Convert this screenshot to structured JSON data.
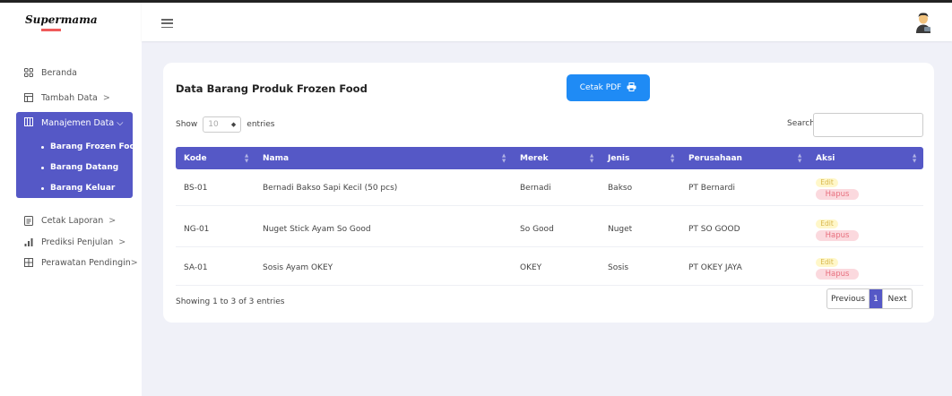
{
  "app": {
    "logo_text": "Supermama"
  },
  "sidebar": {
    "items": [
      {
        "label": "Beranda",
        "icon": "grid-icon",
        "arrow": ""
      },
      {
        "label": "Tambah Data",
        "icon": "table-icon",
        "arrow": ">"
      },
      {
        "label": "Manajemen Data",
        "icon": "columns-icon",
        "arrow": "⌵"
      },
      {
        "label": "Cetak Laporan",
        "icon": "document-icon",
        "arrow": ">"
      },
      {
        "label": "Prediksi Penjulan",
        "icon": "bar-chart-icon",
        "arrow": ">"
      },
      {
        "label": "Perawatan Pendingin",
        "icon": "grid-plus-icon",
        "arrow": ">"
      }
    ],
    "sub_items": [
      "Barang Frozen Food",
      "Barang Datang",
      "Barang Keluar"
    ],
    "accent": "#5558c6"
  },
  "main": {
    "title": "Data Barang Produk Frozen Food",
    "pdf_button": "Cetak PDF",
    "show_label": "Show",
    "entries_value": "10",
    "entries_label": "entries",
    "search_label": "Search:",
    "columns": [
      "Kode",
      "Nama",
      "Merek",
      "Jenis",
      "Perusahaan",
      "Aksi"
    ],
    "rows": [
      {
        "kode": "BS-01",
        "nama": "Bernadi Bakso Sapi Kecil (50 pcs)",
        "merek": "Bernadi",
        "jenis": "Bakso",
        "perusahaan": "PT Bernardi"
      },
      {
        "kode": "NG-01",
        "nama": "Nuget Stick Ayam So Good",
        "merek": "So Good",
        "jenis": "Nuget",
        "perusahaan": "PT SO GOOD"
      },
      {
        "kode": "SA-01",
        "nama": "Sosis Ayam OKEY",
        "merek": "OKEY",
        "jenis": "Sosis",
        "perusahaan": "PT OKEY JAYA"
      }
    ],
    "edit_label": "Edit",
    "hapus_label": "Hapus",
    "info": "Showing 1 to 3 of 3 entries",
    "pagination": {
      "previous": "Previous",
      "current": "1",
      "next": "Next"
    }
  }
}
